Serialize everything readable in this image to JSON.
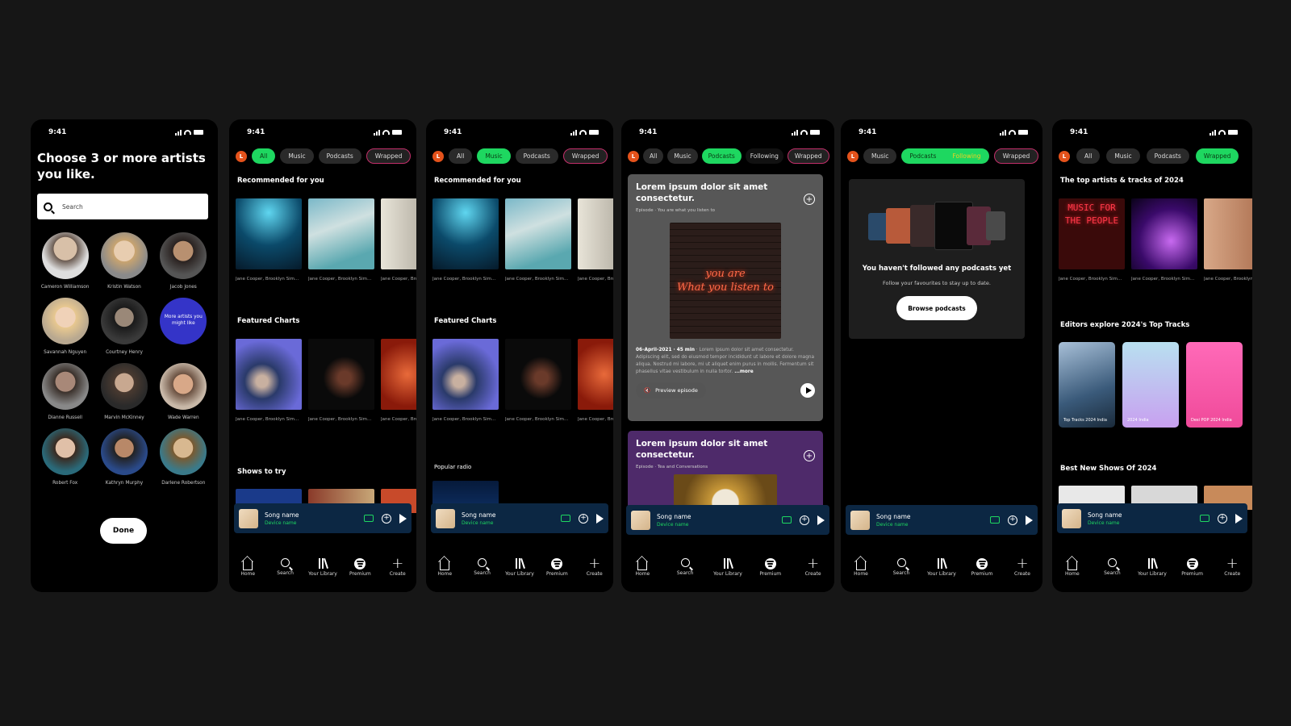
{
  "status_time": "9:41",
  "onboarding": {
    "title": "Choose 3 or more artists you like.",
    "search_placeholder": "Search",
    "artists": [
      "Cameron Williamson",
      "Kristin Watson",
      "Jacob Jones",
      "Savannah Nguyen",
      "Courtney Henry",
      "More artists you might like",
      "Dianne Russell",
      "Marvin McKinney",
      "Wade Warren",
      "Robert Fox",
      "Kathryn Murphy",
      "Darlene Robertson"
    ],
    "done_label": "Done"
  },
  "filters": {
    "avatar": "L",
    "all": "All",
    "music": "Music",
    "podcasts": "Podcasts",
    "following": "Following",
    "wrapped": "Wrapped"
  },
  "home": {
    "recommended": "Recommended for you",
    "featured": "Featured Charts",
    "shows": "Shows to try",
    "popular_radio": "Popular radio",
    "card_caption": "Jane Cooper, Brooklyn Simmons, Jenny Wilson, ..."
  },
  "podcasts": {
    "ep1_title": "Lorem ipsum dolor sit amet consectetur.",
    "ep1_sub": "Episode · You are what you listen to",
    "neon_line1": "you are",
    "neon_line2": "What you listen to",
    "ep1_meta": "06-April-2021 · 45 min",
    "ep1_desc": " · Lorem ipsum dolor sit amet consectetur. Adipiscing elit, sed do eiusmod tempor incididunt ut labore et dolore magna aliqua. Nostrud mi labore, mi ut aliquet enim purus in mollis. Fermentum sit phasellus vitae vestibulum in nulla tortor.",
    "ep1_more": "...more",
    "preview": "Preview episode",
    "ep2_title": "Lorem ipsum dolor sit amet consectetur.",
    "ep2_sub": "Episode · Tea and Conversations"
  },
  "following": {
    "heading": "You haven't followed any podcasts yet",
    "body": "Follow your favourites to stay up to date.",
    "button": "Browse podcasts"
  },
  "wrapped": {
    "top": "The top artists & tracks of 2024",
    "editors": "Editors explore 2024's Top Tracks",
    "best": "Best New Shows Of 2024",
    "neon_text": "MUSIC FOR THE PEOPLE",
    "tile1": "Top Tracks 2024 India",
    "tile2": "2024 India",
    "tile3": "Desi POP 2024 India"
  },
  "player": {
    "song": "Song name",
    "device": "Device name"
  },
  "nav": {
    "home": "Home",
    "search": "Search",
    "library": "Your Library",
    "premium": "Premium",
    "create": "Create"
  },
  "colors": {
    "accent": "#1ed760",
    "player_bg": "#0c2743",
    "more_artists": "#3434c8",
    "wrapped_border": "#c32f6a"
  }
}
